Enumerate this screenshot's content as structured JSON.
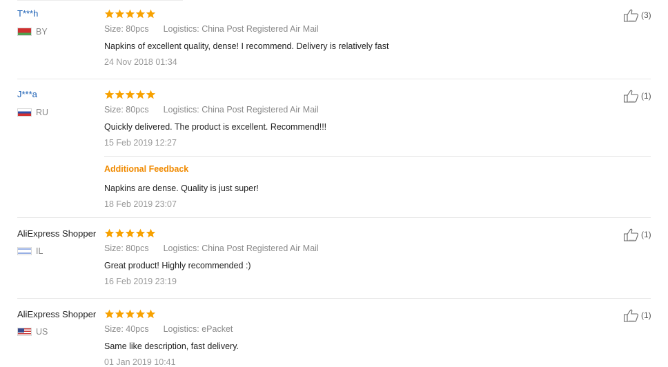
{
  "reviews": [
    {
      "user": "T***h",
      "country": "BY",
      "flag": "belarus-flag-icon",
      "rating": 5,
      "size_label": "Size:",
      "size_value": "80pcs",
      "logistics_label": "Logistics:",
      "logistics_value": "China Post Registered Air Mail",
      "text": "Napkins of excellent quality, dense! I recommend. Delivery is relatively fast",
      "date": "24 Nov 2018 01:34",
      "helpful": "(3)"
    },
    {
      "user": "J***a",
      "country": "RU",
      "flag": "russia-flag-icon",
      "rating": 5,
      "size_label": "Size:",
      "size_value": "80pcs",
      "logistics_label": "Logistics:",
      "logistics_value": "China Post Registered Air Mail",
      "text": "Quickly delivered. The product is excellent. Recommend!!!",
      "date": "15 Feb 2019 12:27",
      "additional_label": "Additional Feedback",
      "additional_text": "Napkins are dense. Quality is just super!",
      "additional_date": "18 Feb 2019 23:07",
      "helpful": "(1)"
    },
    {
      "user": "AliExpress Shopper",
      "country": "IL",
      "flag": "israel-flag-icon",
      "rating": 5,
      "size_label": "Size:",
      "size_value": "80pcs",
      "logistics_label": "Logistics:",
      "logistics_value": "China Post Registered Air Mail",
      "text": "Great product! Highly recommended :)",
      "date": "16 Feb 2019 23:19",
      "helpful": "(1)"
    },
    {
      "user": "AliExpress Shopper",
      "country": "US",
      "flag": "usa-flag-icon",
      "rating": 5,
      "size_label": "Size:",
      "size_value": "40pcs",
      "logistics_label": "Logistics:",
      "logistics_value": "ePacket",
      "text": "Same like description, fast delivery.",
      "date": "01 Jan 2019 10:41",
      "helpful": "(1)"
    }
  ],
  "colors": {
    "star": "#f7a100",
    "masked_user": "#1a5fb4",
    "additional_feedback": "#f08a00",
    "meta_text": "#888888"
  },
  "icons": {
    "star": "star-icon",
    "helpful": "thumbs-up-icon"
  }
}
